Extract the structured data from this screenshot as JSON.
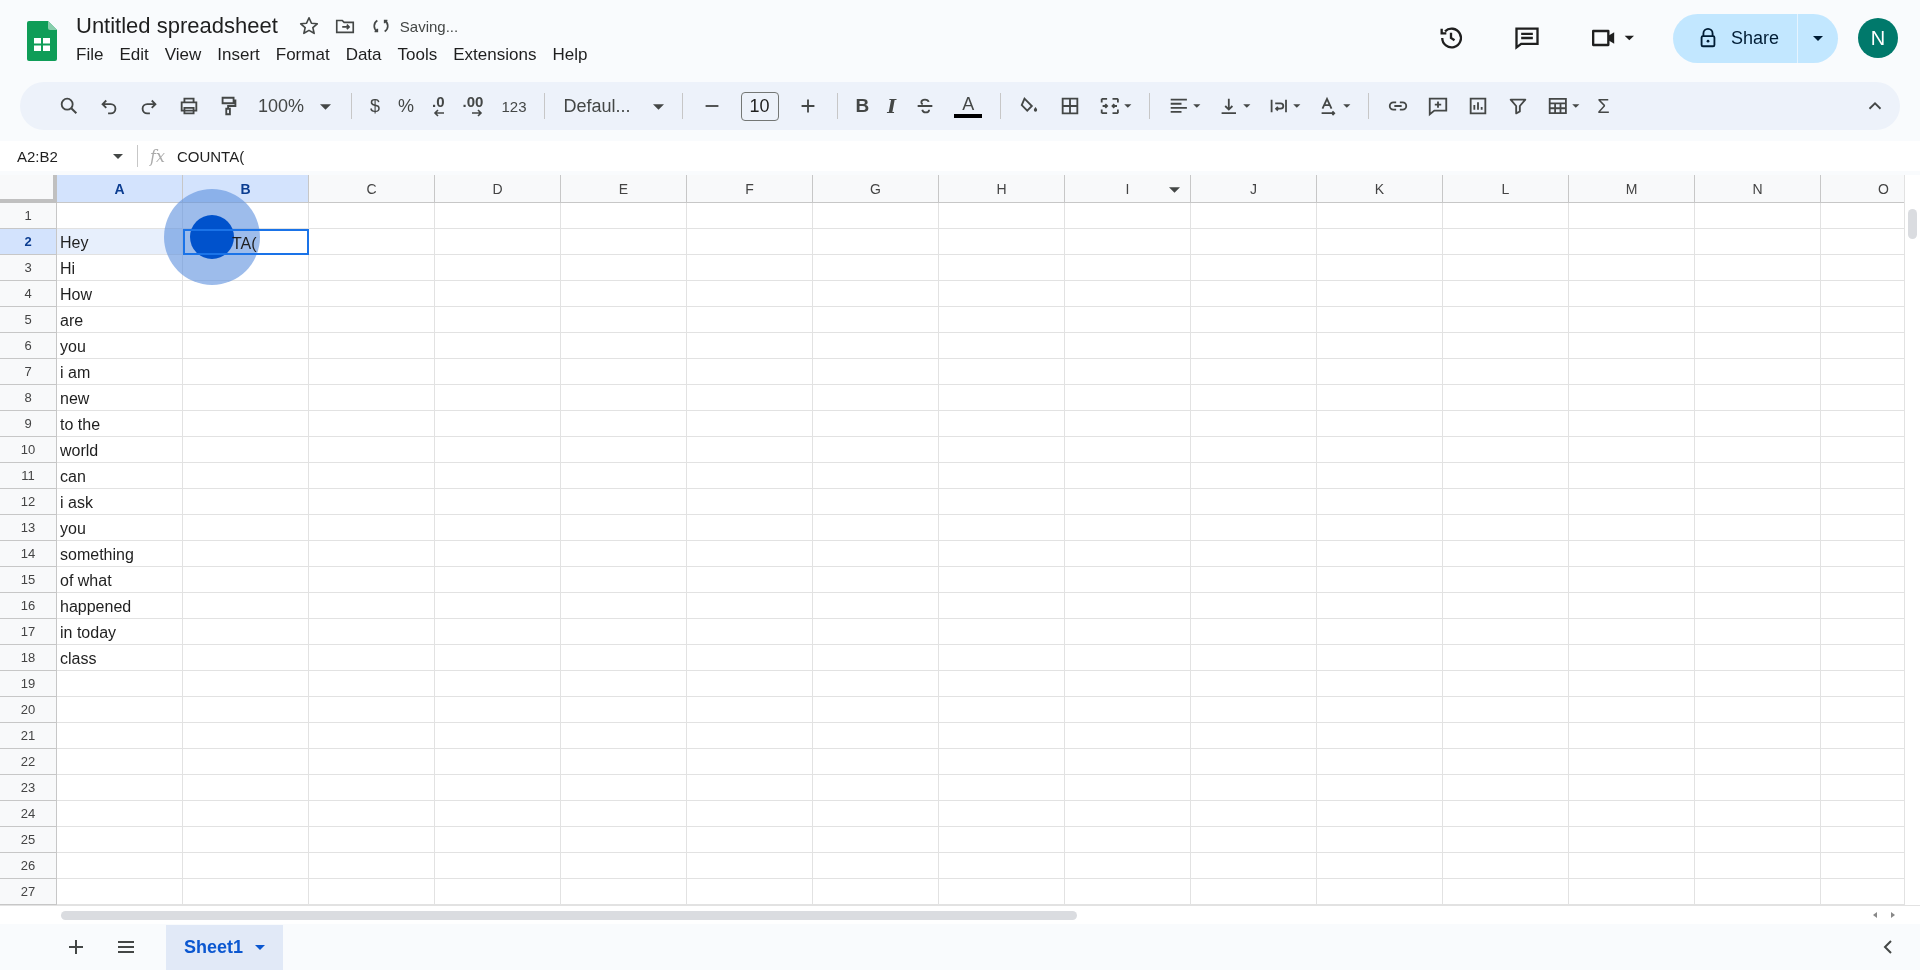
{
  "title": "Untitled spreadsheet",
  "save_status": "Saving...",
  "menu": [
    "File",
    "Edit",
    "View",
    "Insert",
    "Format",
    "Data",
    "Tools",
    "Extensions",
    "Help"
  ],
  "share": "Share",
  "avatar": "N",
  "toolbar": {
    "zoom": "100%",
    "currency": "$",
    "percent": "%",
    "decrease_decimals": ".0",
    "increase_decimals": ".00",
    "number_format": "123",
    "font": "Defaul...",
    "font_size": "10",
    "bold": "B",
    "italic": "I",
    "text_color": "A",
    "sum": "Σ"
  },
  "name_box": "A2:B2",
  "fx": "fx",
  "formula": "COUNTA(",
  "columns": [
    {
      "label": "A",
      "selected": true
    },
    {
      "label": "B",
      "selected": true
    },
    {
      "label": "C",
      "selected": false
    },
    {
      "label": "D",
      "selected": false
    },
    {
      "label": "E",
      "selected": false
    },
    {
      "label": "F",
      "selected": false
    },
    {
      "label": "G",
      "selected": false
    },
    {
      "label": "H",
      "selected": false
    },
    {
      "label": "I",
      "selected": false
    },
    {
      "label": "J",
      "selected": false
    },
    {
      "label": "K",
      "selected": false
    },
    {
      "label": "L",
      "selected": false
    },
    {
      "label": "M",
      "selected": false
    },
    {
      "label": "N",
      "selected": false
    },
    {
      "label": "O",
      "selected": false
    }
  ],
  "rows": [
    {
      "number": "1",
      "selected": false
    },
    {
      "number": "2",
      "selected": true,
      "a": "Hey",
      "b": "TA("
    },
    {
      "number": "3",
      "selected": false,
      "a": "Hi"
    },
    {
      "number": "4",
      "selected": false,
      "a": "How"
    },
    {
      "number": "5",
      "selected": false,
      "a": "are"
    },
    {
      "number": "6",
      "selected": false,
      "a": "you"
    },
    {
      "number": "7",
      "selected": false,
      "a": "i am"
    },
    {
      "number": "8",
      "selected": false,
      "a": "new"
    },
    {
      "number": "9",
      "selected": false,
      "a": "to the"
    },
    {
      "number": "10",
      "selected": false,
      "a": "world"
    },
    {
      "number": "11",
      "selected": false,
      "a": "can"
    },
    {
      "number": "12",
      "selected": false,
      "a": "i ask"
    },
    {
      "number": "13",
      "selected": false,
      "a": "you"
    },
    {
      "number": "14",
      "selected": false,
      "a": "something"
    },
    {
      "number": "15",
      "selected": false,
      "a": "of what"
    },
    {
      "number": "16",
      "selected": false,
      "a": "happened"
    },
    {
      "number": "17",
      "selected": false,
      "a": "in today"
    },
    {
      "number": "18",
      "selected": false,
      "a": "class"
    },
    {
      "number": "19",
      "selected": false
    },
    {
      "number": "20",
      "selected": false
    },
    {
      "number": "21",
      "selected": false
    },
    {
      "number": "22",
      "selected": false
    },
    {
      "number": "23",
      "selected": false
    },
    {
      "number": "24",
      "selected": false
    },
    {
      "number": "25",
      "selected": false
    },
    {
      "number": "26",
      "selected": false
    },
    {
      "number": "27",
      "selected": false
    }
  ],
  "sheets": [
    {
      "label": "Sheet1",
      "selected": true
    }
  ]
}
